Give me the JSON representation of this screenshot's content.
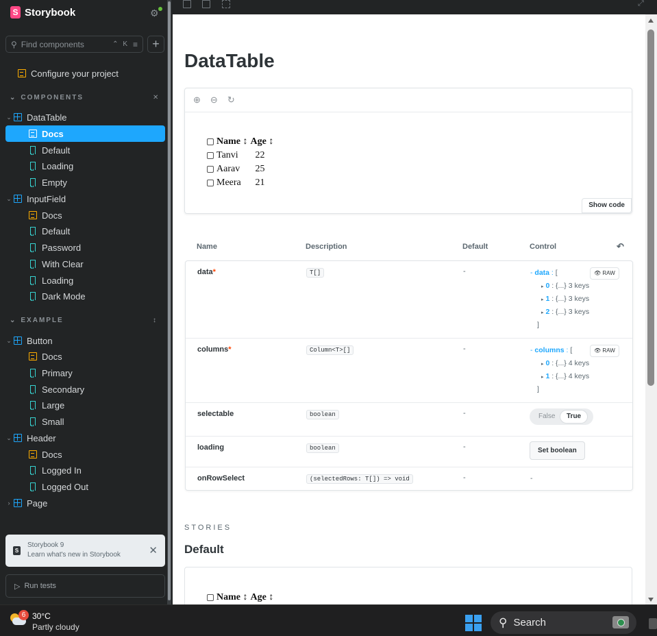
{
  "app": {
    "brand": "Storybook"
  },
  "search": {
    "placeholder": "Find components",
    "shortcut": "⌃ K"
  },
  "sidebar": {
    "configure": "Configure your project",
    "sections": [
      {
        "label": "COMPONENTS"
      },
      {
        "label": "EXAMPLE"
      }
    ],
    "items": [
      {
        "label": "DataTable"
      },
      {
        "label": "Docs"
      },
      {
        "label": "Default"
      },
      {
        "label": "Loading"
      },
      {
        "label": "Empty"
      },
      {
        "label": "InputField"
      },
      {
        "label": "Docs"
      },
      {
        "label": "Default"
      },
      {
        "label": "Password"
      },
      {
        "label": "With Clear"
      },
      {
        "label": "Loading"
      },
      {
        "label": "Dark Mode"
      },
      {
        "label": "Button"
      },
      {
        "label": "Docs"
      },
      {
        "label": "Primary"
      },
      {
        "label": "Secondary"
      },
      {
        "label": "Large"
      },
      {
        "label": "Small"
      },
      {
        "label": "Header"
      },
      {
        "label": "Docs"
      },
      {
        "label": "Logged In"
      },
      {
        "label": "Logged Out"
      },
      {
        "label": "Page"
      }
    ],
    "notice": {
      "title": "Storybook 9",
      "subtitle": "Learn what's new in Storybook"
    },
    "run_tests": "Run tests"
  },
  "doc": {
    "title": "DataTable",
    "show_code": "Show code",
    "table": {
      "headers": [
        "Name ↕",
        "Age ↕"
      ],
      "rows": [
        {
          "name": "Tanvi",
          "age": "22"
        },
        {
          "name": "Aarav",
          "age": "25"
        },
        {
          "name": "Meera",
          "age": "21"
        }
      ]
    },
    "args_headers": {
      "name": "Name",
      "description": "Description",
      "default": "Default",
      "control": "Control"
    },
    "args": [
      {
        "name": "data",
        "required": "*",
        "type": "T[]",
        "default": "-"
      },
      {
        "name": "columns",
        "required": "*",
        "type": "Column<T>[]",
        "default": "-"
      },
      {
        "name": "selectable",
        "type": "boolean",
        "default": "-"
      },
      {
        "name": "loading",
        "type": "boolean",
        "default": "-"
      },
      {
        "name": "onRowSelect",
        "type": "(selectedRows: T[]) => void",
        "default": "-"
      }
    ],
    "controls": {
      "raw": "RAW",
      "data_key": "data",
      "data_entries": [
        {
          "key": "0",
          "value": ": {...} 3 keys"
        },
        {
          "key": "1",
          "value": ": {...} 3 keys"
        },
        {
          "key": "2",
          "value": ": {...} 3 keys"
        }
      ],
      "columns_key": "columns",
      "columns_entries": [
        {
          "key": "0",
          "value": ": {...} 4 keys"
        },
        {
          "key": "1",
          "value": ": {...} 4 keys"
        }
      ],
      "toggle_false": "False",
      "toggle_true": "True",
      "set_boolean": "Set boolean",
      "none": "-"
    },
    "stories_label": "STORIES",
    "story_title": "Default",
    "story_headers": [
      "Name ↕",
      "Age ↕"
    ]
  },
  "taskbar": {
    "temp": "30°C",
    "condition": "Partly cloudy",
    "badge": "6",
    "search": "Search"
  },
  "colors": {
    "accent": "#1ea7fd",
    "brand": "#ff4785",
    "doc": "#ffae00",
    "story": "#37d5d3"
  }
}
